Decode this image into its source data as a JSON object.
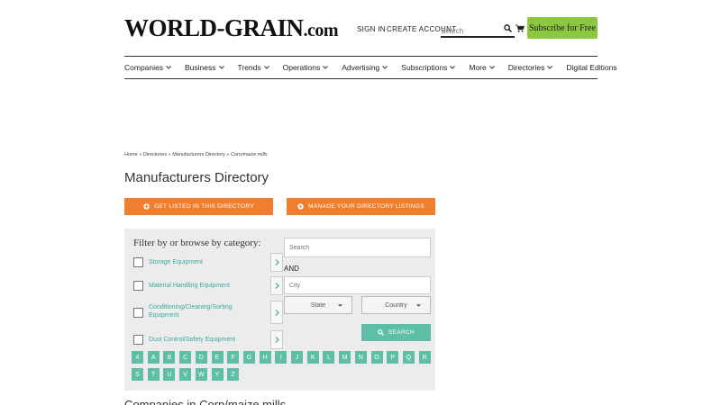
{
  "header": {
    "logo_main": "WORLD-GRAIN",
    "logo_suffix": ".com",
    "sign_in": "SIGN IN",
    "create_account": "CREATE ACCOUNT",
    "search_placeholder": "Search",
    "subscribe": "Subscribe for Free"
  },
  "nav": {
    "items": [
      {
        "label": "Companies",
        "dropdown": true
      },
      {
        "label": "Business",
        "dropdown": true
      },
      {
        "label": "Trends",
        "dropdown": true
      },
      {
        "label": "Operations",
        "dropdown": true
      },
      {
        "label": "Advertising",
        "dropdown": true
      },
      {
        "label": "Subscriptions",
        "dropdown": true
      },
      {
        "label": "More",
        "dropdown": true
      },
      {
        "label": "Directories",
        "dropdown": true
      },
      {
        "label": "Digital Editions",
        "dropdown": false
      }
    ]
  },
  "breadcrumb": {
    "home": "Home",
    "directories": "Directories",
    "manufacturers": "Manufacturers Directory",
    "current": "Corn/maize mills",
    "separator": " » "
  },
  "page": {
    "title": "Manufacturers Directory",
    "get_listed": "GET LISTED IN THIS DIRECTORY",
    "manage_listings": "MANAGE YOUR DIRECTORY LISTINGS"
  },
  "filter": {
    "title": "Filter by or browse by category:",
    "categories": [
      "Storage Equipment",
      "Material Handling Equipment",
      "Conditioning/Cleaning/Sorting Equipment",
      "Dust Control/Safety Equipment"
    ],
    "search_placeholder": "Search",
    "and_label": "AND",
    "city_placeholder": "City",
    "state_label": "State",
    "country_label": "Country",
    "search_button": "SEARCH",
    "letters": [
      "4",
      "A",
      "B",
      "C",
      "D",
      "E",
      "F",
      "G",
      "H",
      "I",
      "J",
      "K",
      "L",
      "M",
      "N",
      "O",
      "P",
      "Q",
      "R",
      "S",
      "T",
      "U",
      "V",
      "W",
      "Y",
      "Z"
    ]
  },
  "bottom": {
    "heading": "Companies in Corn/maize mills"
  },
  "colors": {
    "orange": "#ef7f2e",
    "teal": "#5fbfa6",
    "link_teal": "#3aa99f",
    "subscribe_green": "#8dc63f"
  }
}
